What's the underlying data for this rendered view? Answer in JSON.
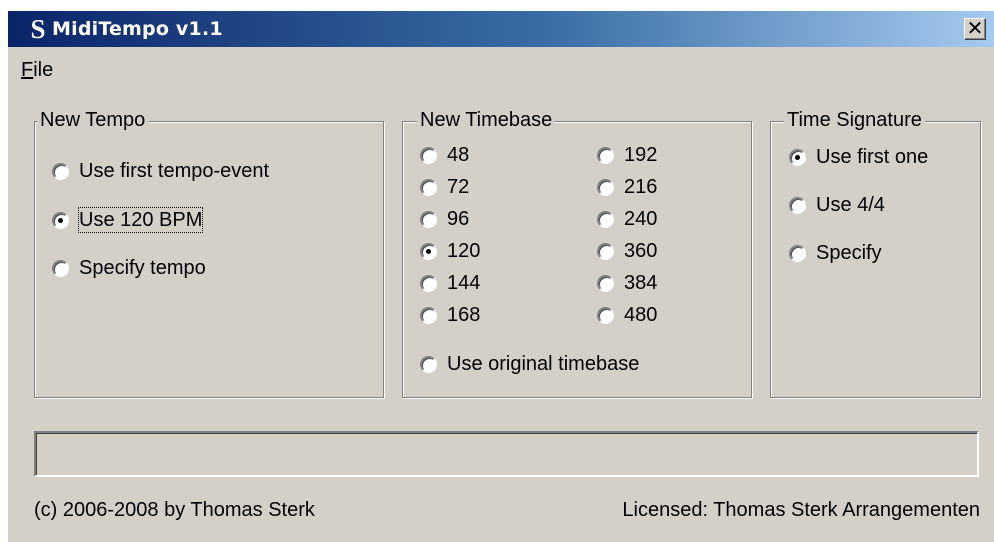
{
  "window": {
    "title": "MidiTempo v1.1",
    "icon_glyph": "S",
    "close_glyph": "✕"
  },
  "menu": {
    "file_accel": "F",
    "file_rest": "ile"
  },
  "new_tempo": {
    "legend": "New Tempo",
    "options": [
      {
        "label": "Use first tempo-event",
        "selected": false
      },
      {
        "label": "Use 120 BPM",
        "selected": true
      },
      {
        "label": "Specify tempo",
        "selected": false
      }
    ]
  },
  "new_timebase": {
    "legend": "New Timebase",
    "left_column": [
      {
        "label": "48",
        "selected": false
      },
      {
        "label": "72",
        "selected": false
      },
      {
        "label": "96",
        "selected": false
      },
      {
        "label": "120",
        "selected": true
      },
      {
        "label": "144",
        "selected": false
      },
      {
        "label": "168",
        "selected": false
      }
    ],
    "right_column": [
      {
        "label": "192",
        "selected": false
      },
      {
        "label": "216",
        "selected": false
      },
      {
        "label": "240",
        "selected": false
      },
      {
        "label": "360",
        "selected": false
      },
      {
        "label": "384",
        "selected": false
      },
      {
        "label": "480",
        "selected": false
      }
    ],
    "original": {
      "label": "Use original timebase",
      "selected": false
    }
  },
  "time_signature": {
    "legend": "Time Signature",
    "options": [
      {
        "label": "Use first one",
        "selected": true
      },
      {
        "label": "Use 4/4",
        "selected": false
      },
      {
        "label": "Specify",
        "selected": false
      }
    ]
  },
  "progress": {
    "value": 0
  },
  "footer": {
    "copyright": "(c) 2006-2008 by Thomas Sterk",
    "license": "Licensed: Thomas Sterk Arrangementen"
  }
}
